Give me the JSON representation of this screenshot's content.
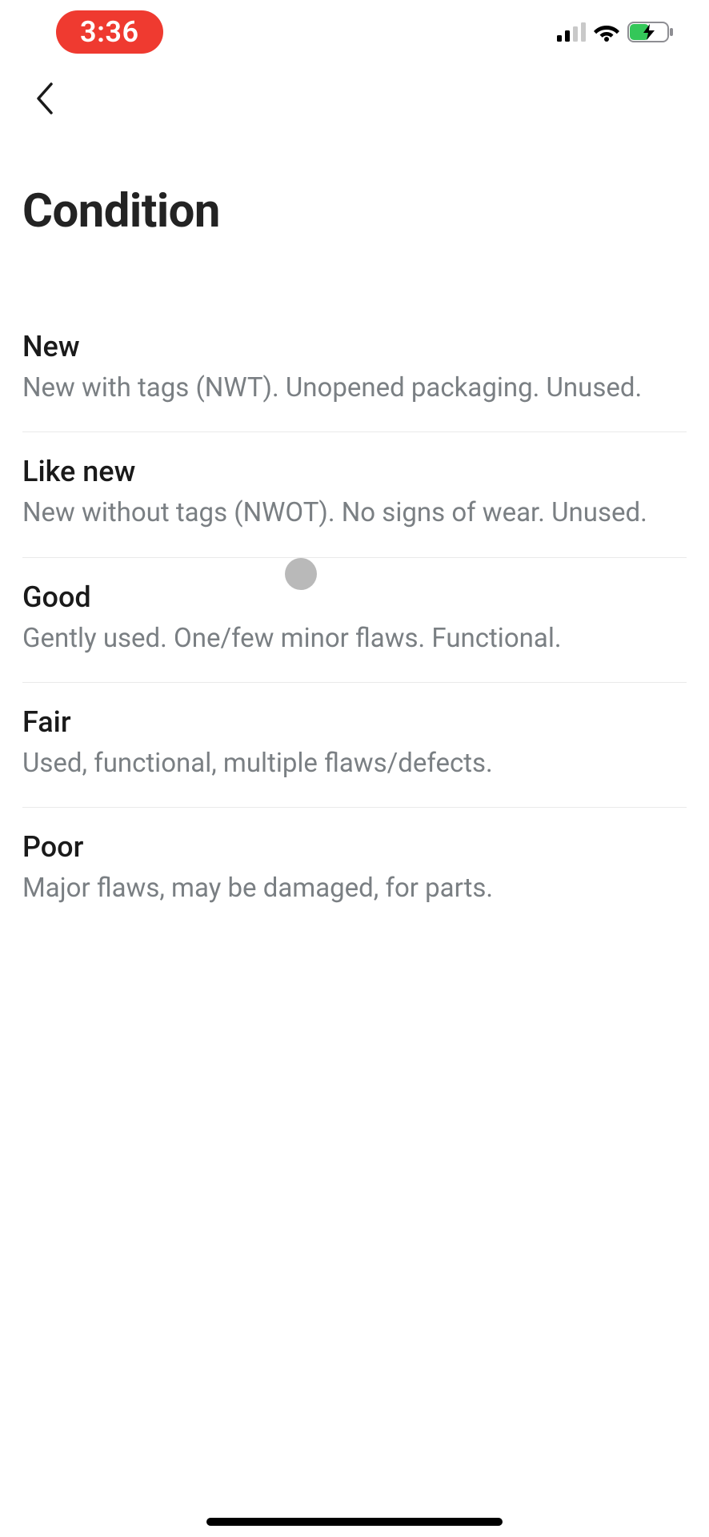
{
  "status": {
    "time": "3:36"
  },
  "page": {
    "title": "Condition"
  },
  "options": [
    {
      "title": "New",
      "desc": "New with tags (NWT). Unopened packaging. Unused."
    },
    {
      "title": "Like new",
      "desc": "New without tags (NWOT). No signs of wear. Unused."
    },
    {
      "title": "Good",
      "desc": "Gently used. One/few minor flaws. Functional."
    },
    {
      "title": "Fair",
      "desc": "Used, functional, multiple flaws/defects."
    },
    {
      "title": "Poor",
      "desc": "Major flaws, may be damaged, for parts."
    }
  ]
}
